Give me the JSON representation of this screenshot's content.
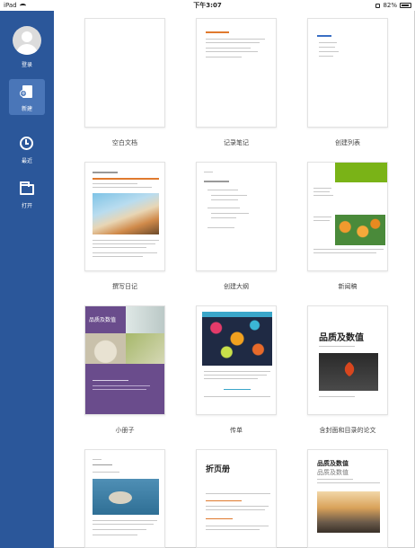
{
  "status_bar": {
    "device": "iPad",
    "time": "下午3:07",
    "battery": "82%"
  },
  "sidebar": {
    "sign_in": "登录",
    "items": [
      {
        "label": "新建",
        "icon": "new-document-icon",
        "active": true
      },
      {
        "label": "最近",
        "icon": "clock-icon",
        "active": false
      },
      {
        "label": "打开",
        "icon": "folder-icon",
        "active": false
      }
    ]
  },
  "templates": [
    {
      "label": "空白文档"
    },
    {
      "label": "记录笔记"
    },
    {
      "label": "创建列表"
    },
    {
      "label": "撰写日记"
    },
    {
      "label": "创建大纲"
    },
    {
      "label": "新闻稿"
    },
    {
      "label": "小册子"
    },
    {
      "label": "传单"
    },
    {
      "label": "含封面和目录的论文"
    },
    {
      "label": ""
    },
    {
      "label": ""
    },
    {
      "label": ""
    }
  ],
  "thumb_text": {
    "brochure_title": "品质及数值",
    "paper_title": "品质及数值",
    "report_title": "品质及数值",
    "report_subtitle": "品质及数值",
    "foldout_title": "折页册"
  },
  "colors": {
    "sidebar": "#2b579a",
    "sidebar_active": "#4a76b8",
    "accent_orange": "#e07a2e",
    "accent_green": "#7ab317",
    "brochure_purple": "#6a4c8c"
  }
}
